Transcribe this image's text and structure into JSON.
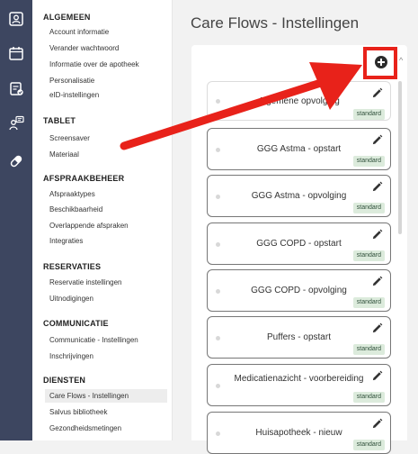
{
  "page": {
    "title": "Care Flows - Instellingen"
  },
  "rail": {
    "icons": [
      "user-card-icon",
      "calendar-icon",
      "clipboard-check-icon",
      "user-chat-icon",
      "pill-icon"
    ]
  },
  "nav": {
    "sections": [
      {
        "heading": "ALGEMEEN",
        "items": [
          "Account informatie",
          "Verander wachtwoord",
          "Informatie over de apotheek",
          "Personalisatie",
          "eID-instellingen"
        ]
      },
      {
        "heading": "TABLET",
        "items": [
          "Screensaver",
          "Materiaal"
        ]
      },
      {
        "heading": "AFSPRAAKBEHEER",
        "items": [
          "Afspraaktypes",
          "Beschikbaarheid",
          "Overlappende afspraken",
          "Integraties"
        ]
      },
      {
        "heading": "RESERVATIES",
        "items": [
          "Reservatie instellingen",
          "Uitnodigingen"
        ]
      },
      {
        "heading": "COMMUNICATIE",
        "items": [
          "Communicatie - Instellingen",
          "Inschrijvingen"
        ]
      },
      {
        "heading": "DIENSTEN",
        "items": [
          "Care Flows - Instellingen",
          "Salvus bibliotheek",
          "Gezondheidsmetingen"
        ]
      }
    ],
    "active_item": "Care Flows - Instellingen"
  },
  "care_flows": [
    {
      "name": "Algemene opvolging",
      "badge": "standard"
    },
    {
      "name": "GGG Astma - opstart",
      "badge": "standard"
    },
    {
      "name": "GGG Astma - opvolging",
      "badge": "standard"
    },
    {
      "name": "GGG COPD - opstart",
      "badge": "standard"
    },
    {
      "name": "GGG COPD - opvolging",
      "badge": "standard"
    },
    {
      "name": "Puffers - opstart",
      "badge": "standard"
    },
    {
      "name": "Medicatienazicht - voorbereiding",
      "badge": "standard"
    },
    {
      "name": "Huisapotheek - nieuw",
      "badge": "standard"
    }
  ],
  "colors": {
    "rail": "#3d4660",
    "highlight": "#e8221a",
    "badge_bg": "#dcebdc"
  }
}
